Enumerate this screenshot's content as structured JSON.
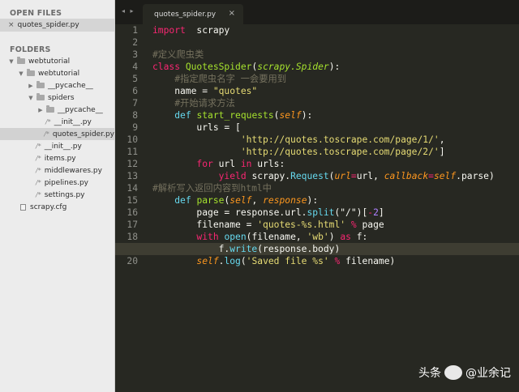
{
  "sidebar": {
    "open_files_heading": "OPEN FILES",
    "open_file": {
      "close": "×",
      "name": "quotes_spider.py"
    },
    "folders_heading": "FOLDERS",
    "tree": [
      {
        "label": "webtutorial",
        "kind": "folder",
        "expanded": true,
        "depth": 0
      },
      {
        "label": "webtutorial",
        "kind": "folder",
        "expanded": true,
        "depth": 1
      },
      {
        "label": "__pycache__",
        "kind": "folder",
        "expanded": false,
        "depth": 2
      },
      {
        "label": "spiders",
        "kind": "folder",
        "expanded": true,
        "depth": 2
      },
      {
        "label": "__pycache__",
        "kind": "folder",
        "expanded": false,
        "depth": 3
      },
      {
        "label": "__init__.py",
        "kind": "file",
        "depth": 3
      },
      {
        "label": "quotes_spider.py",
        "kind": "file",
        "depth": 3,
        "selected": true
      },
      {
        "label": "__init__.py",
        "kind": "file",
        "depth": 2
      },
      {
        "label": "items.py",
        "kind": "file",
        "depth": 2
      },
      {
        "label": "middlewares.py",
        "kind": "file",
        "depth": 2
      },
      {
        "label": "pipelines.py",
        "kind": "file",
        "depth": 2
      },
      {
        "label": "settings.py",
        "kind": "file",
        "depth": 2
      },
      {
        "label": "scrapy.cfg",
        "kind": "doc",
        "depth": 1
      }
    ]
  },
  "tabbar": {
    "nav": "◂ ▸",
    "tab_label": "quotes_spider.py",
    "tab_close": "×"
  },
  "editor": {
    "current_line": 19,
    "line_numbers": [
      "1",
      "2",
      "3",
      "4",
      "5",
      "6",
      "7",
      "8",
      "9",
      "10",
      "11",
      "12",
      "13",
      "14",
      "15",
      "16",
      "17",
      "18",
      "19",
      "20"
    ],
    "lines": [
      [
        [
          "kw",
          "import"
        ],
        [
          "",
          "  scrapy"
        ]
      ],
      [],
      [
        [
          "cm",
          "#定义爬虫类"
        ]
      ],
      [
        [
          "kw",
          "class"
        ],
        [
          "",
          " "
        ],
        [
          "cls",
          "QuotesSpider"
        ],
        [
          "",
          "("
        ],
        [
          "ital",
          "scrapy.Spider"
        ],
        [
          "",
          "):"
        ]
      ],
      [
        [
          "",
          "    "
        ],
        [
          "cm",
          "#指定爬虫名字 一会要用到"
        ]
      ],
      [
        [
          "",
          "    name = "
        ],
        [
          "st",
          "\"quotes\""
        ]
      ],
      [
        [
          "",
          "    "
        ],
        [
          "cm",
          "#开始请求方法"
        ]
      ],
      [
        [
          "",
          "    "
        ],
        [
          "bi",
          "def"
        ],
        [
          "",
          " "
        ],
        [
          "fn",
          "start_requests"
        ],
        [
          "",
          "("
        ],
        [
          "sf",
          "self"
        ],
        [
          "",
          "):"
        ]
      ],
      [
        [
          "",
          "        urls = ["
        ]
      ],
      [
        [
          "",
          "                "
        ],
        [
          "st",
          "'http://quotes.toscrape.com/page/1/'"
        ],
        [
          "",
          ","
        ]
      ],
      [
        [
          "",
          "                "
        ],
        [
          "st",
          "'http://quotes.toscrape.com/page/2/'"
        ],
        [
          "",
          "]"
        ]
      ],
      [
        [
          "",
          "        "
        ],
        [
          "kw",
          "for"
        ],
        [
          "",
          " url "
        ],
        [
          "kw",
          "in"
        ],
        [
          "",
          " urls:"
        ]
      ],
      [
        [
          "",
          "            "
        ],
        [
          "kw",
          "yield"
        ],
        [
          "",
          " scrapy."
        ],
        [
          "bi",
          "Request"
        ],
        [
          "",
          "("
        ],
        [
          "sf",
          "url"
        ],
        [
          "kw",
          "="
        ],
        [
          "",
          "url, "
        ],
        [
          "sf",
          "callback"
        ],
        [
          "kw",
          "="
        ],
        [
          "sf",
          "self"
        ],
        [
          "",
          ".parse)"
        ]
      ],
      [
        [
          "cm",
          "#解析写入返回内容到html中"
        ]
      ],
      [
        [
          "",
          "    "
        ],
        [
          "bi",
          "def"
        ],
        [
          "",
          " "
        ],
        [
          "fn",
          "parse"
        ],
        [
          "",
          "("
        ],
        [
          "sf",
          "self"
        ],
        [
          "",
          ", "
        ],
        [
          "sf",
          "response"
        ],
        [
          "",
          "):"
        ]
      ],
      [
        [
          "",
          "        page = response.url."
        ],
        [
          "bi",
          "split"
        ],
        [
          "",
          "(\"/\")["
        ],
        [
          "kw",
          "-"
        ],
        [
          "nu",
          "2"
        ],
        [
          "",
          "]"
        ]
      ],
      [
        [
          "",
          "        filename = "
        ],
        [
          "st",
          "'quotes-%s.html'"
        ],
        [
          "",
          " "
        ],
        [
          "kw",
          "%"
        ],
        [
          "",
          " page"
        ]
      ],
      [
        [
          "",
          "        "
        ],
        [
          "kw",
          "with"
        ],
        [
          "",
          " "
        ],
        [
          "bi",
          "open"
        ],
        [
          "",
          "(filename, "
        ],
        [
          "st",
          "'wb'"
        ],
        [
          "",
          ") "
        ],
        [
          "kw",
          "as"
        ],
        [
          "",
          " f:"
        ]
      ],
      [
        [
          "",
          "            f."
        ],
        [
          "bi",
          "write"
        ],
        [
          "",
          "(response.body)"
        ]
      ],
      [
        [
          "",
          "        "
        ],
        [
          "sf",
          "self"
        ],
        [
          "",
          "."
        ],
        [
          "bi",
          "log"
        ],
        [
          "",
          "("
        ],
        [
          "st",
          "'Saved file %s'"
        ],
        [
          "",
          " "
        ],
        [
          "kw",
          "%"
        ],
        [
          "",
          " filename)"
        ]
      ]
    ]
  },
  "watermark": {
    "left": "头条",
    "right": "@业余记"
  },
  "colors": {
    "editor_bg": "#272822",
    "sidebar_bg": "#ececec",
    "keyword": "#f92672",
    "string": "#e6db74",
    "comment": "#75715e",
    "function": "#a6e22e",
    "builtin": "#66d9ef",
    "param": "#fd971f",
    "number": "#ae81ff"
  }
}
